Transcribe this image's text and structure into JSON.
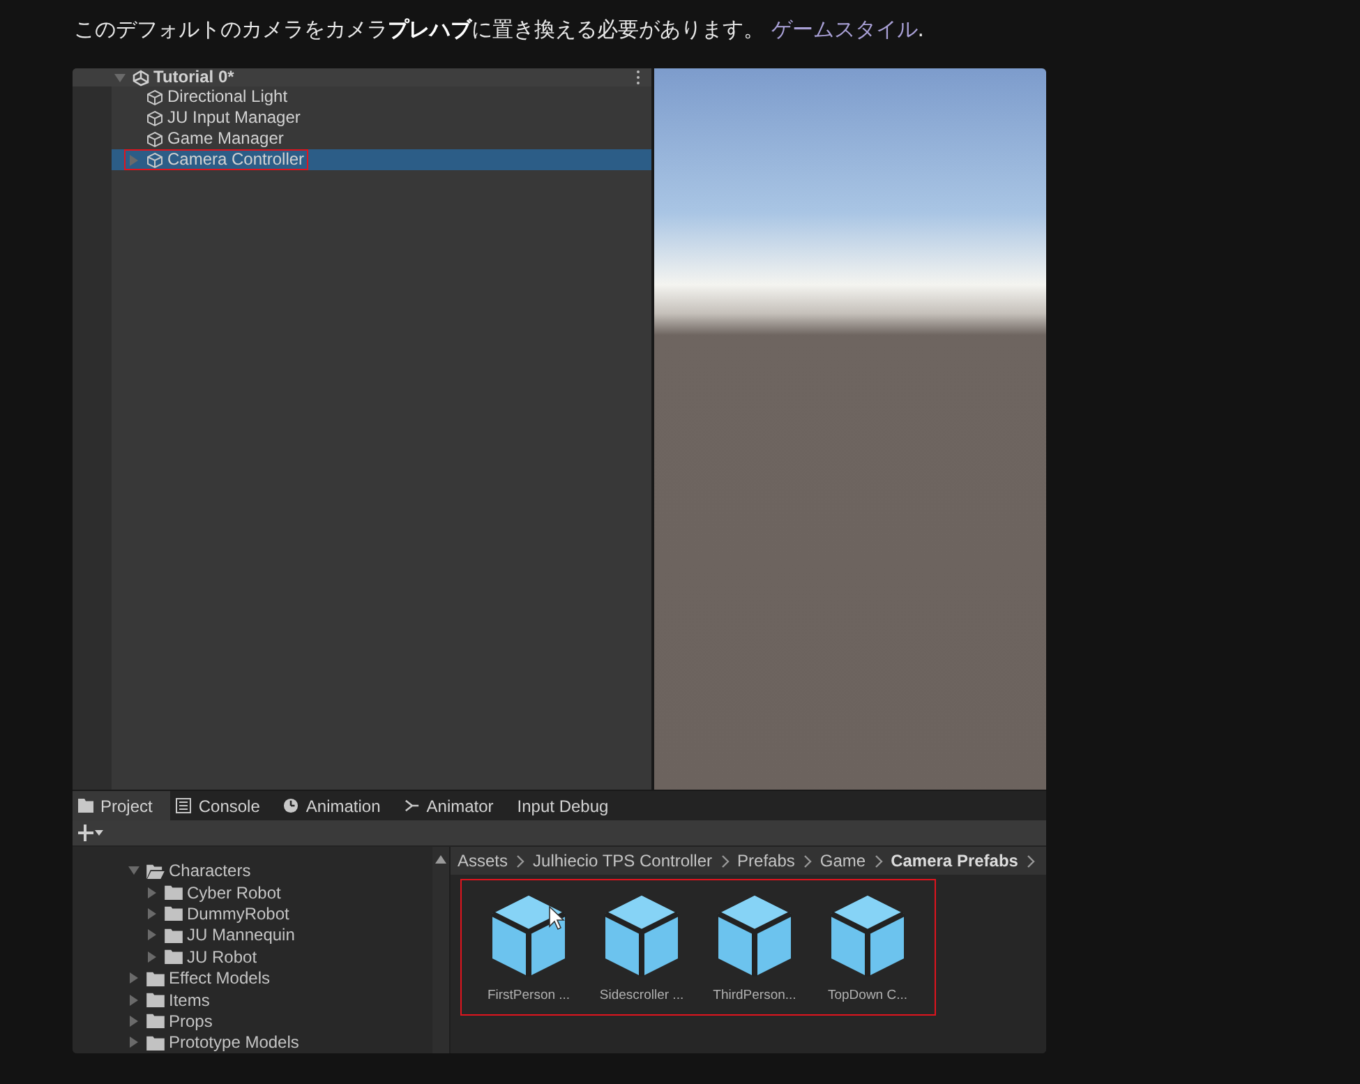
{
  "article": {
    "text": "このデフォルトのカメラをカメラ**プレハブ**に置き換える必要があります。",
    "link": "ゲームスタイル",
    "after": "."
  },
  "hierarchy": {
    "scene": {
      "label": "Tutorial 0*",
      "expanded": true
    },
    "items": [
      {
        "label": "Directional Light",
        "selected": false,
        "highlighted": false,
        "has_children": false
      },
      {
        "label": "JU Input Manager",
        "selected": false,
        "highlighted": false,
        "has_children": false
      },
      {
        "label": "Game Manager",
        "selected": false,
        "highlighted": false,
        "has_children": false
      },
      {
        "label": "Camera Controller",
        "selected": true,
        "highlighted": true,
        "has_children": true
      }
    ]
  },
  "bottom_panel": {
    "tabs": [
      {
        "label": "Project",
        "kind": "folder",
        "selected": true
      },
      {
        "label": "Console",
        "kind": "list",
        "selected": false
      },
      {
        "label": "Animation",
        "kind": "clock",
        "selected": false
      },
      {
        "label": "Animator",
        "kind": "graph",
        "selected": false
      },
      {
        "label": "Input Debug",
        "kind": "plain",
        "selected": false
      }
    ],
    "tree": [
      {
        "label": "Characters",
        "expanded": true,
        "children": [
          {
            "label": "Cyber Robot",
            "expanded": false
          },
          {
            "label": "DummyRobot",
            "expanded": false
          },
          {
            "label": "JU Mannequin",
            "expanded": false
          },
          {
            "label": "JU Robot",
            "expanded": false
          }
        ]
      },
      {
        "label": "Effect Models",
        "expanded": false
      },
      {
        "label": "Items",
        "expanded": false
      },
      {
        "label": "Props",
        "expanded": false
      },
      {
        "label": "Prototype Models",
        "expanded": false
      }
    ],
    "breadcrumb": [
      {
        "label": "Assets",
        "current": false
      },
      {
        "label": "Julhiecio TPS Controller",
        "current": false
      },
      {
        "label": "Prefabs",
        "current": false
      },
      {
        "label": "Game",
        "current": false
      },
      {
        "label": "Camera Prefabs",
        "current": true
      }
    ],
    "assets": {
      "highlighted": true,
      "items": [
        {
          "label": "FirstPerson ..."
        },
        {
          "label": "Sidescroller ..."
        },
        {
          "label": "ThirdPerson..."
        },
        {
          "label": "TopDown C..."
        }
      ]
    }
  }
}
